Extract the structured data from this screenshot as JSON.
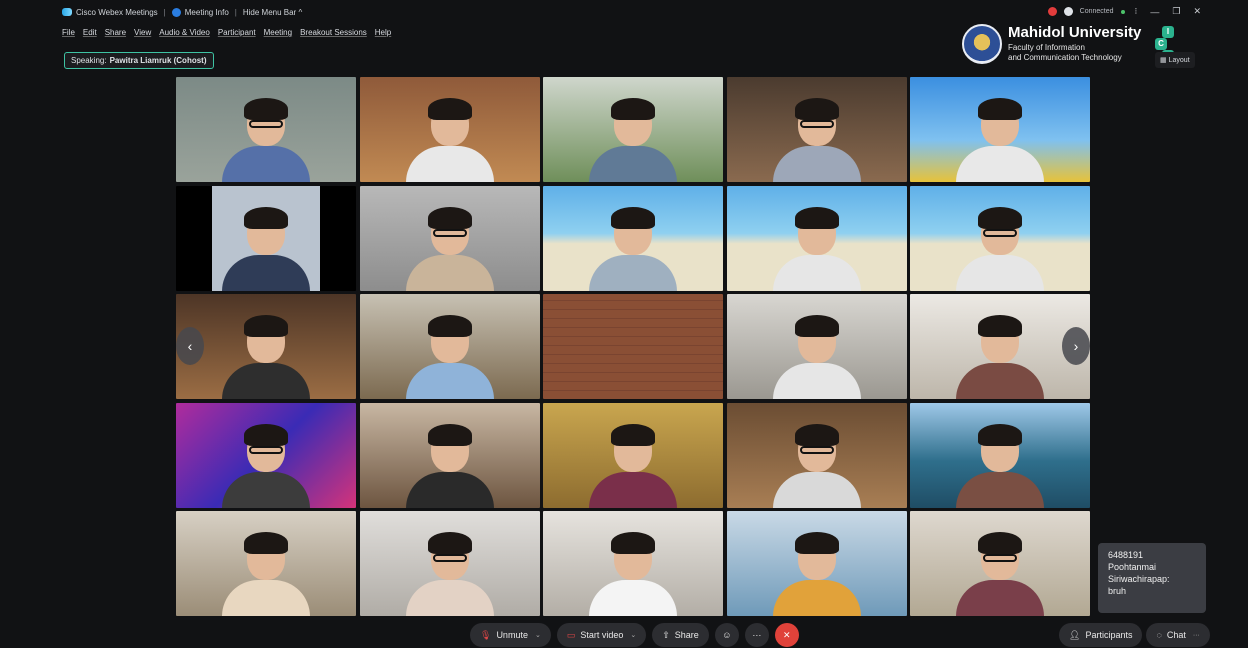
{
  "titlebar": {
    "app_name": "Cisco Webex Meetings",
    "meeting_info": "Meeting Info",
    "hide_menu": "Hide Menu Bar ^",
    "status": "Connected"
  },
  "menu": [
    "File",
    "Edit",
    "Share",
    "View",
    "Audio & Video",
    "Participant",
    "Meeting",
    "Breakout Sessions",
    "Help"
  ],
  "speaking": {
    "label": "Speaking:",
    "name": "Pawitra Liamruk (Cohost)"
  },
  "branding": {
    "name": "Mahidol University",
    "faculty_line1": "Faculty of Information",
    "faculty_line2": "and Communication Technology",
    "ict_letters": [
      "I",
      "C",
      "T"
    ]
  },
  "layout_button": "Layout",
  "chat_popup": [
    "6488191",
    "Poohtanmai",
    "Siriwachirapap:",
    "bruh"
  ],
  "controls": {
    "unmute": "Unmute",
    "start_video": "Start video",
    "share": "Share",
    "participants": "Participants",
    "chat": "Chat",
    "more": "···"
  },
  "icons": {
    "mic": "mic-muted-icon",
    "video": "video-off-icon",
    "share": "share-icon",
    "reactions": "smiley-icon",
    "leave": "close-icon",
    "participants": "people-icon",
    "chat": "chat-bubble-icon"
  },
  "colors": {
    "leave": "#e0423a",
    "speaking_border": "#3ec3a3",
    "muted": "#e04646"
  }
}
